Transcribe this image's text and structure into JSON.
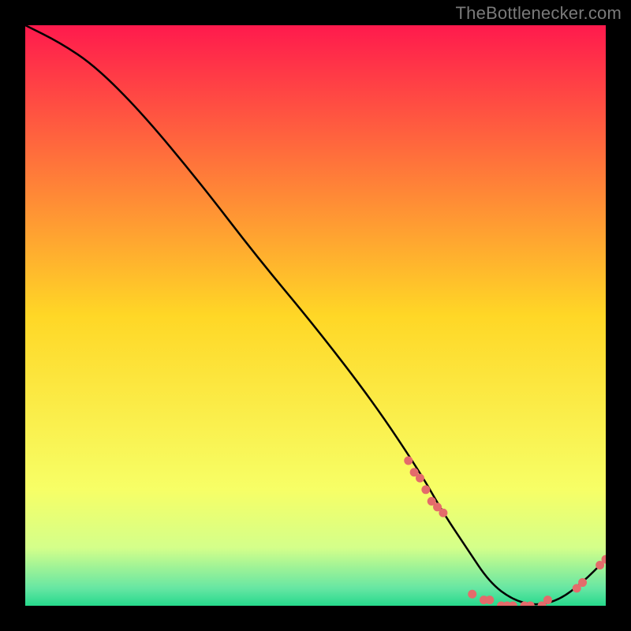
{
  "attribution": "TheBottlenecker.com",
  "chart_data": {
    "type": "line",
    "title": "",
    "xlabel": "",
    "ylabel": "",
    "xlim": [
      0,
      100
    ],
    "ylim": [
      0,
      100
    ],
    "gradient_stops": [
      {
        "offset": 0.0,
        "color": "#ff1a4d"
      },
      {
        "offset": 0.5,
        "color": "#ffd726"
      },
      {
        "offset": 0.8,
        "color": "#f7ff66"
      },
      {
        "offset": 0.9,
        "color": "#d4ff8a"
      },
      {
        "offset": 0.97,
        "color": "#66e6a3"
      },
      {
        "offset": 1.0,
        "color": "#26d98c"
      }
    ],
    "series": [
      {
        "name": "curve",
        "color": "#000000",
        "x": [
          0,
          6,
          12,
          20,
          30,
          40,
          50,
          60,
          68,
          72,
          76,
          80,
          84,
          88,
          92,
          96,
          100
        ],
        "y": [
          100,
          97,
          93,
          85,
          73,
          60,
          48,
          35,
          23,
          16,
          10,
          4,
          1,
          0,
          1,
          4,
          8
        ]
      }
    ],
    "markers": {
      "color": "#e46b6b",
      "points": [
        {
          "x": 66,
          "y": 25
        },
        {
          "x": 67,
          "y": 23
        },
        {
          "x": 68,
          "y": 22
        },
        {
          "x": 69,
          "y": 20
        },
        {
          "x": 70,
          "y": 18
        },
        {
          "x": 71,
          "y": 17
        },
        {
          "x": 72,
          "y": 16
        },
        {
          "x": 77,
          "y": 2
        },
        {
          "x": 79,
          "y": 1
        },
        {
          "x": 80,
          "y": 1
        },
        {
          "x": 82,
          "y": 0
        },
        {
          "x": 83,
          "y": 0
        },
        {
          "x": 84,
          "y": 0
        },
        {
          "x": 86,
          "y": 0
        },
        {
          "x": 87,
          "y": 0
        },
        {
          "x": 89,
          "y": 0
        },
        {
          "x": 90,
          "y": 1
        },
        {
          "x": 95,
          "y": 3
        },
        {
          "x": 96,
          "y": 4
        },
        {
          "x": 99,
          "y": 7
        },
        {
          "x": 100,
          "y": 8
        }
      ]
    }
  }
}
